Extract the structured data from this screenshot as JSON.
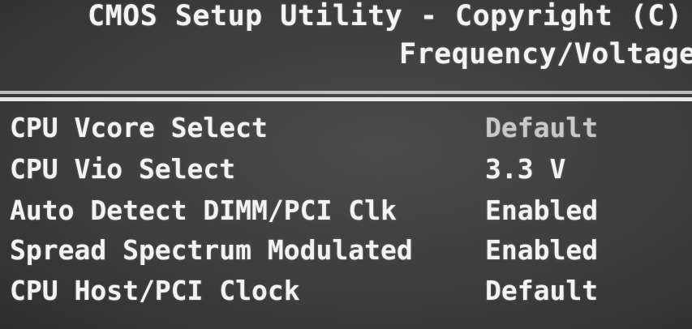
{
  "header": {
    "title": "CMOS Setup Utility - Copyright (C)",
    "subtitle": "Frequency/Voltage"
  },
  "settings": [
    {
      "label": "CPU Vcore Select",
      "value": "Default",
      "selected": true
    },
    {
      "label": "CPU Vio Select",
      "value": "3.3 V",
      "selected": false
    },
    {
      "label": "Auto Detect DIMM/PCI Clk",
      "value": "Enabled",
      "selected": false
    },
    {
      "label": "Spread Spectrum Modulated",
      "value": "Enabled",
      "selected": false
    },
    {
      "label": "CPU Host/PCI Clock",
      "value": "Default",
      "selected": false
    }
  ],
  "colors": {
    "background": "#3c3c3c",
    "text": "#f3f3f3",
    "selected_value": "#c9c9c9",
    "divider": "#e6e6e6"
  }
}
